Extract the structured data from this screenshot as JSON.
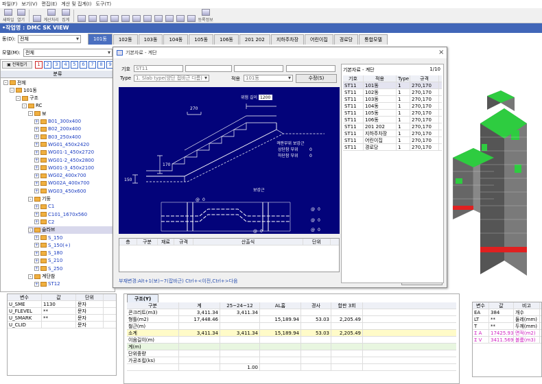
{
  "menu": [
    "파일(F)",
    "보기(V)",
    "편집(E)",
    "계산 및 집계(I)",
    "도구(T)"
  ],
  "toolbar": {
    "items": [
      "새파일",
      "열기",
      "",
      "계산처리",
      "집계",
      "",
      "",
      "",
      "",
      "",
      "",
      "",
      "",
      "",
      "",
      "",
      "등록정보"
    ]
  },
  "project_title": "•작업명 : DMC SK VIEW",
  "dong": {
    "label": "동(D):",
    "value": "전체"
  },
  "model": {
    "label": "모델(M):",
    "value": "전체"
  },
  "tabs": [
    "101동",
    "102동",
    "103동",
    "104동",
    "105동",
    "106동",
    "201 202",
    "지하주차장",
    "어린이집",
    "경로당",
    "통합모델"
  ],
  "left": {
    "header": "분류",
    "nums": [
      "1",
      "2",
      "3",
      "4",
      "5",
      "6",
      "7",
      "8",
      "9"
    ],
    "tree": [
      {
        "t": "전체",
        "d": 0,
        "exp": "-"
      },
      {
        "t": "101동",
        "d": 1,
        "exp": "-"
      },
      {
        "t": "구조",
        "d": 2,
        "exp": "-"
      },
      {
        "t": "RC",
        "d": 3,
        "exp": "-"
      },
      {
        "t": "보",
        "d": 4,
        "exp": "-"
      },
      {
        "t": "B01_300x400",
        "d": 5,
        "exp": "+",
        "b": 1
      },
      {
        "t": "B02_200x400",
        "d": 5,
        "exp": "+",
        "b": 1
      },
      {
        "t": "B03_250x400",
        "d": 5,
        "exp": "+",
        "b": 1
      },
      {
        "t": "WG01_450x2420",
        "d": 5,
        "exp": "+",
        "b": 1
      },
      {
        "t": "WG01-1_450x2720",
        "d": 5,
        "exp": "+",
        "b": 1
      },
      {
        "t": "WG01-2_450x2800",
        "d": 5,
        "exp": "+",
        "b": 1
      },
      {
        "t": "WG01-3_450x2100",
        "d": 5,
        "exp": "+",
        "b": 1
      },
      {
        "t": "WG02_400x700",
        "d": 5,
        "exp": "+",
        "b": 1
      },
      {
        "t": "WG02A_400x700",
        "d": 5,
        "exp": "+",
        "b": 1
      },
      {
        "t": "WG03_450x600",
        "d": 5,
        "exp": "+",
        "b": 1
      },
      {
        "t": "기둥",
        "d": 4,
        "exp": "-"
      },
      {
        "t": "C1",
        "d": 5,
        "exp": "+",
        "b": 1
      },
      {
        "t": "C101_1670x560",
        "d": 5,
        "exp": "+",
        "b": 1
      },
      {
        "t": "C2",
        "d": 5,
        "exp": "+",
        "b": 1
      },
      {
        "t": "슬라브",
        "d": 4,
        "exp": "-",
        "sel": 1
      },
      {
        "t": "S_150",
        "d": 5,
        "exp": "+",
        "b": 1
      },
      {
        "t": "S_150(+)",
        "d": 5,
        "exp": "+",
        "b": 1
      },
      {
        "t": "S_180",
        "d": 5,
        "exp": "+",
        "b": 1
      },
      {
        "t": "S_210",
        "d": 5,
        "exp": "+",
        "b": 1
      },
      {
        "t": "S_250",
        "d": 5,
        "exp": "+",
        "b": 1
      },
      {
        "t": "계단참",
        "d": 4,
        "exp": "-"
      },
      {
        "t": "ST12",
        "d": 5,
        "exp": "+",
        "b": 1
      }
    ]
  },
  "vars": {
    "headers": [
      "변수",
      "값",
      "단위"
    ],
    "rows": [
      [
        "U_SME",
        "1130",
        "문자"
      ],
      [
        "U_FLEVEL",
        "**",
        "문자"
      ],
      [
        "U_SMARK",
        "**",
        "문자"
      ],
      [
        "U_CLID",
        "",
        "문자"
      ]
    ]
  },
  "dialog": {
    "title": "기본자료 - 계단",
    "code_label": "기호",
    "code_value": "ST11",
    "type_label": "Type",
    "type_value": "1. Slab type(양단 접바근 다름)",
    "apply_label": "적용",
    "apply_value": "101동",
    "edit_btn": "수정(S)",
    "close_btn": "닫기(X)",
    "hint": "부재변경:Alt+1(보)~7(잡바근)  Ctrl+<이전,Ctrl+>다음",
    "diagram": {
      "w_len": "위험 길이",
      "w_val": "1200",
      "d270": "270",
      "d170": "170",
      "d150": "150",
      "t1": "격판부위 보강근",
      "t2": "상단참 부위",
      "t3": "하단참 부위",
      "z": "0",
      "dash": "-",
      "bogang": "보강근",
      "at": "@",
      "v0": "0"
    },
    "table_headers": [
      "층",
      "구분",
      "재료",
      "규격",
      "산출식",
      "단위"
    ],
    "list": {
      "title": "기본자료 - 계단",
      "page": "1/10",
      "headers": [
        "기호",
        "적용",
        "Type",
        "규격"
      ],
      "rows": [
        [
          "ST11",
          "101동",
          "1",
          "270,170"
        ],
        [
          "ST11",
          "102동",
          "1",
          "270,170"
        ],
        [
          "ST11",
          "103동",
          "1",
          "270,170"
        ],
        [
          "ST11",
          "104동",
          "1",
          "270,170"
        ],
        [
          "ST11",
          "105동",
          "1",
          "270,170"
        ],
        [
          "ST11",
          "106동",
          "1",
          "270,170"
        ],
        [
          "ST11",
          "201 202",
          "1",
          "270,170"
        ],
        [
          "ST11",
          "지하주차장",
          "1",
          "270,170"
        ],
        [
          "ST11",
          "어린이집",
          "1",
          "270,170"
        ],
        [
          "ST11",
          "경로당",
          "1",
          "270,170"
        ]
      ]
    }
  },
  "calc": {
    "tab": "구조(Y)",
    "headers": [
      "구분",
      "계",
      "25~24~12",
      "AL홈",
      "경사",
      "합판 3회"
    ],
    "rows": [
      [
        "콘크리트(m3)",
        "3,411.34",
        "3,411.34",
        "",
        "",
        ""
      ],
      [
        "형틀(m2)",
        "17,448.46",
        "",
        "15,189.94",
        "53.03",
        "2,205.49"
      ],
      [
        "철근(m)",
        "",
        "",
        "",
        "",
        ""
      ],
      [
        "소계",
        "3,411.34",
        "3,411.34",
        "15,189.94",
        "53.03",
        "2,205.49"
      ],
      [
        "이음길이(m)",
        "",
        "",
        "",
        "",
        ""
      ],
      [
        "계(m)",
        "",
        "",
        "",
        "",
        ""
      ],
      [
        "단위중량",
        "",
        "",
        "",
        "",
        ""
      ],
      [
        "가공조립(ks)",
        "",
        "",
        "",
        "",
        ""
      ],
      [
        "",
        "",
        "1.00",
        "",
        "",
        ""
      ]
    ]
  },
  "vars2": {
    "headers": [
      "변수",
      "값",
      "비고"
    ],
    "rows": [
      [
        "EA",
        "384",
        "개수"
      ],
      [
        "LT",
        "**",
        "둘레(mm)"
      ],
      [
        "T",
        "**",
        "두께(mm)"
      ],
      [
        "Σ A",
        "17425.933",
        "면적(m2)"
      ],
      [
        "Σ V",
        "3411.569",
        "볼륨(m3)"
      ]
    ]
  }
}
